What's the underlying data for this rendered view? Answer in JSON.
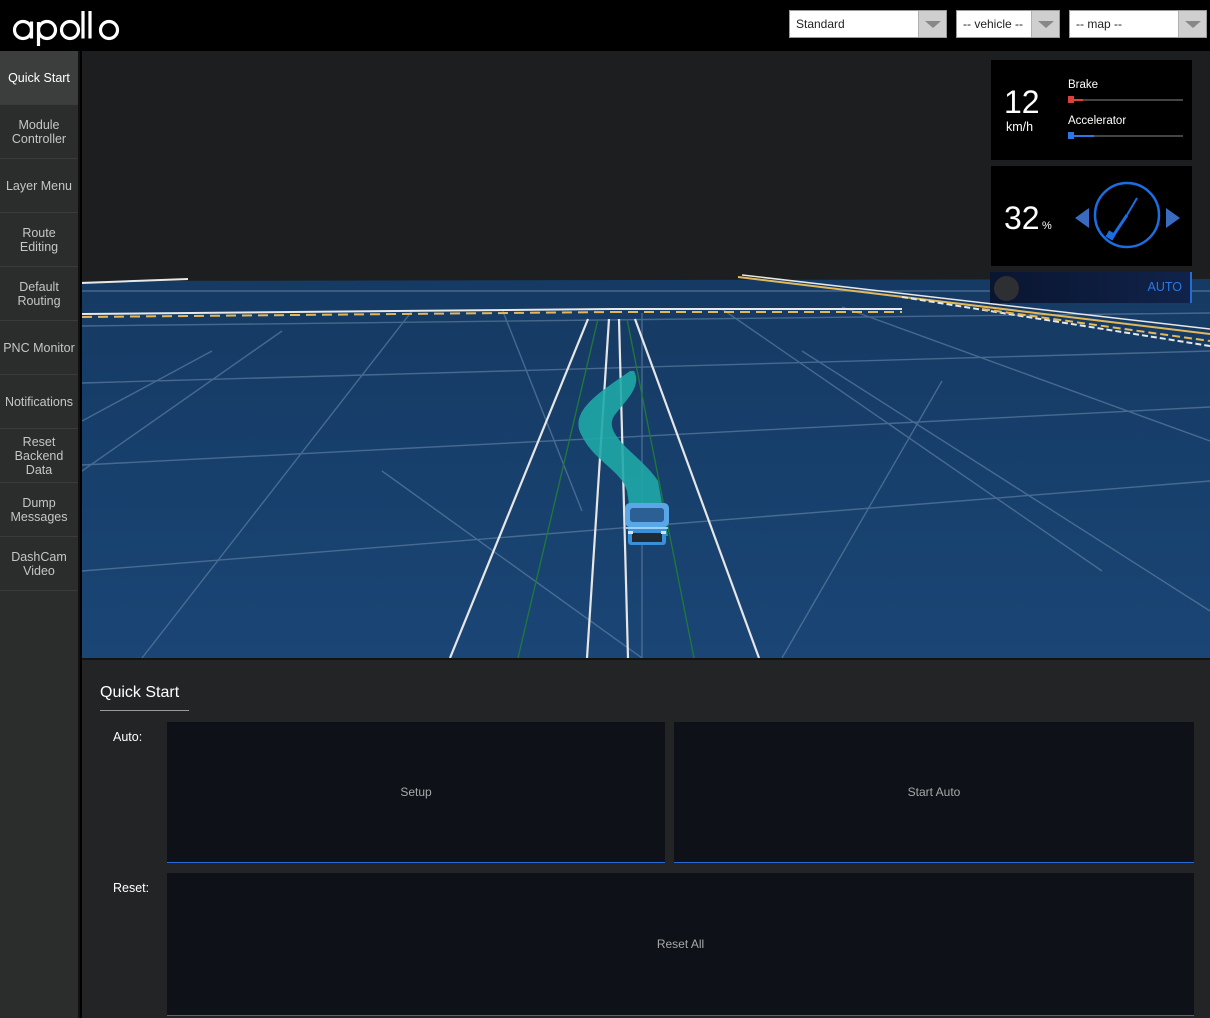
{
  "header": {
    "logo_text": "apollo",
    "mode_select": {
      "value": "Standard"
    },
    "vehicle_select": {
      "value": "-- vehicle --"
    },
    "map_select": {
      "value": "-- map --"
    }
  },
  "sidebar": {
    "items": [
      {
        "label": "Quick Start",
        "active": true
      },
      {
        "label": "Module\nController",
        "active": false
      },
      {
        "label": "Layer Menu",
        "active": false
      },
      {
        "label": "Route Editing",
        "active": false
      },
      {
        "label": "Default\nRouting",
        "active": false
      },
      {
        "label": "PNC Monitor",
        "active": false
      },
      {
        "label": "Notifications",
        "active": false
      },
      {
        "label": "Reset\nBackend\nData",
        "active": false
      },
      {
        "label": "Dump\nMessages",
        "active": false
      },
      {
        "label": "DashCam\nVideo",
        "active": false
      }
    ]
  },
  "dashboard": {
    "speed": {
      "value": "12",
      "unit": "km/h"
    },
    "brake": {
      "label": "Brake",
      "color": "#d9423a",
      "level": 0.12
    },
    "accelerator": {
      "label": "Accelerator",
      "color": "#2b78e4",
      "level": 0.22
    },
    "steering": {
      "value": "32",
      "unit": "%"
    },
    "driving_mode": "AUTO"
  },
  "quick_start": {
    "title": "Quick Start",
    "auto_label": "Auto:",
    "reset_label": "Reset:",
    "setup_label": "Setup",
    "start_auto_label": "Start Auto",
    "reset_all_label": "Reset All"
  },
  "colors": {
    "ground": "#173d66",
    "trajectory": "#1fa7a7",
    "accent": "#2b78e4"
  }
}
